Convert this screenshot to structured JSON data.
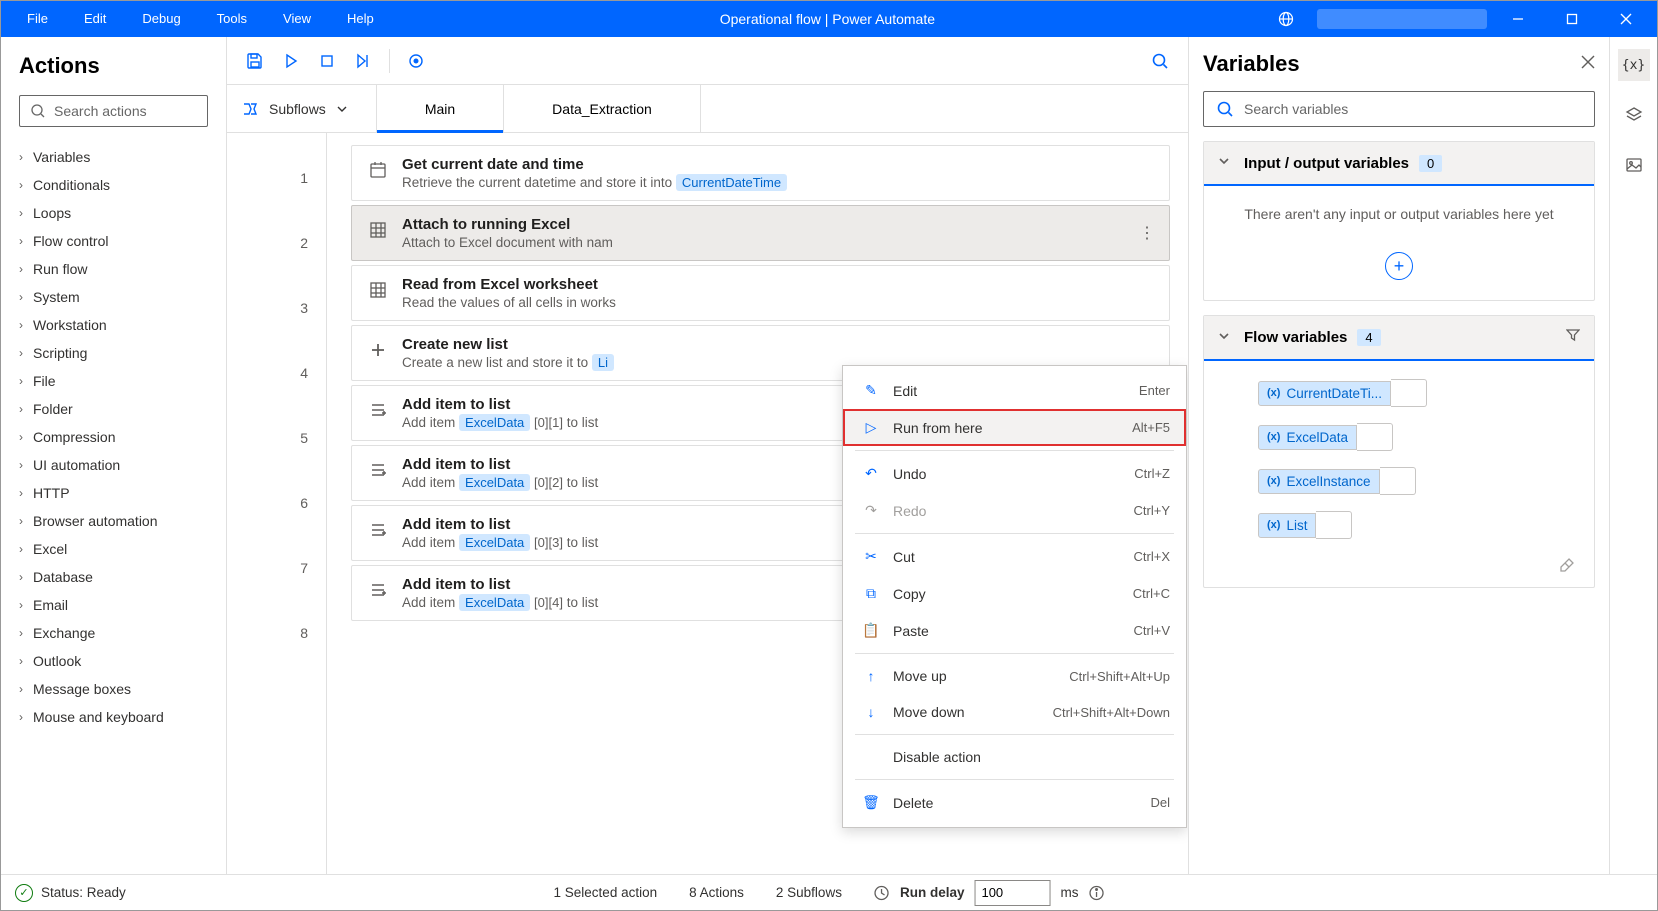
{
  "titlebar": {
    "menus": [
      "File",
      "Edit",
      "Debug",
      "Tools",
      "View",
      "Help"
    ],
    "title": "Operational flow | Power Automate"
  },
  "actions": {
    "heading": "Actions",
    "search_placeholder": "Search actions",
    "categories": [
      "Variables",
      "Conditionals",
      "Loops",
      "Flow control",
      "Run flow",
      "System",
      "Workstation",
      "Scripting",
      "File",
      "Folder",
      "Compression",
      "UI automation",
      "HTTP",
      "Browser automation",
      "Excel",
      "Database",
      "Email",
      "Exchange",
      "Outlook",
      "Message boxes",
      "Mouse and keyboard"
    ]
  },
  "subflows": {
    "label": "Subflows",
    "tabs": [
      "Main",
      "Data_Extraction"
    ]
  },
  "steps": [
    {
      "n": "1",
      "title": "Get current date and time",
      "desc_pre": "Retrieve the current datetime and store it into ",
      "token": "CurrentDateTime"
    },
    {
      "n": "2",
      "title": "Attach to running Excel",
      "desc_pre": "Attach to Excel document with nam",
      "selected": true
    },
    {
      "n": "3",
      "title": "Read from Excel worksheet",
      "desc_pre": "Read the values of all cells in works"
    },
    {
      "n": "4",
      "title": "Create new list",
      "desc_pre": "Create a new list and store it to ",
      "token": "Li"
    },
    {
      "n": "5",
      "title": "Add item to list",
      "desc_pre": "Add item ",
      "token": "ExcelData",
      "idx": "[0][1]",
      "desc_post": " to list"
    },
    {
      "n": "6",
      "title": "Add item to list",
      "desc_pre": "Add item ",
      "token": "ExcelData",
      "idx": "[0][2]",
      "desc_post": " to list"
    },
    {
      "n": "7",
      "title": "Add item to list",
      "desc_pre": "Add item ",
      "token": "ExcelData",
      "idx": "[0][3]",
      "desc_post": " to list"
    },
    {
      "n": "8",
      "title": "Add item to list",
      "desc_pre": "Add item ",
      "token": "ExcelData",
      "idx": "[0][4]",
      "desc_post": " to list"
    }
  ],
  "context_menu": [
    {
      "label": "Edit",
      "shortcut": "Enter",
      "icon": "pencil"
    },
    {
      "label": "Run from here",
      "shortcut": "Alt+F5",
      "icon": "play",
      "highlighted": true
    },
    {
      "sep": true
    },
    {
      "label": "Undo",
      "shortcut": "Ctrl+Z",
      "icon": "undo"
    },
    {
      "label": "Redo",
      "shortcut": "Ctrl+Y",
      "icon": "redo",
      "disabled": true
    },
    {
      "sep": true
    },
    {
      "label": "Cut",
      "shortcut": "Ctrl+X",
      "icon": "cut"
    },
    {
      "label": "Copy",
      "shortcut": "Ctrl+C",
      "icon": "copy"
    },
    {
      "label": "Paste",
      "shortcut": "Ctrl+V",
      "icon": "paste"
    },
    {
      "sep": true
    },
    {
      "label": "Move up",
      "shortcut": "Ctrl+Shift+Alt+Up",
      "icon": "up"
    },
    {
      "label": "Move down",
      "shortcut": "Ctrl+Shift+Alt+Down",
      "icon": "down"
    },
    {
      "sep": true
    },
    {
      "label": "Disable action"
    },
    {
      "sep": true
    },
    {
      "label": "Delete",
      "shortcut": "Del",
      "icon": "trash"
    }
  ],
  "vars": {
    "heading": "Variables",
    "search_placeholder": "Search variables",
    "io_section": {
      "title": "Input / output variables",
      "count": "0",
      "empty": "There aren't any input or output variables here yet"
    },
    "flow_section": {
      "title": "Flow variables",
      "count": "4"
    },
    "flow_vars": [
      "CurrentDateTi...",
      "ExcelData",
      "ExcelInstance",
      "List"
    ]
  },
  "statusbar": {
    "status": "Status: Ready",
    "selected": "1 Selected action",
    "actions": "8 Actions",
    "subflows": "2 Subflows",
    "delay_label": "Run delay",
    "delay_value": "100",
    "delay_unit": "ms"
  }
}
